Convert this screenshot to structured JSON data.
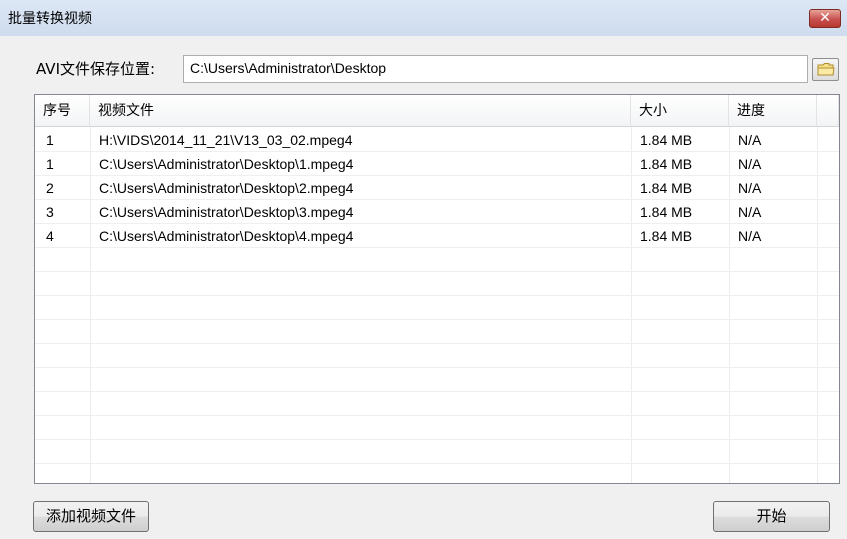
{
  "window": {
    "title": "批量转换视频",
    "close_label": "✕"
  },
  "save_location": {
    "label": "AVI文件保存位置:",
    "value": "C:\\Users\\Administrator\\Desktop"
  },
  "table": {
    "columns": [
      "序号",
      "视频文件",
      "大小",
      "进度"
    ],
    "rows": [
      [
        "1",
        "H:\\VIDS\\2014_11_21\\V13_03_02.mpeg4",
        "1.84 MB",
        "N/A"
      ],
      [
        "1",
        "C:\\Users\\Administrator\\Desktop\\1.mpeg4",
        "1.84 MB",
        "N/A"
      ],
      [
        "2",
        "C:\\Users\\Administrator\\Desktop\\2.mpeg4",
        "1.84 MB",
        "N/A"
      ],
      [
        "3",
        "C:\\Users\\Administrator\\Desktop\\3.mpeg4",
        "1.84 MB",
        "N/A"
      ],
      [
        "4",
        "C:\\Users\\Administrator\\Desktop\\4.mpeg4",
        "1.84 MB",
        "N/A"
      ]
    ]
  },
  "buttons": {
    "add_label": "添加视频文件",
    "start_label": "开始"
  },
  "icons": {
    "folder": "folder-icon",
    "close": "close-icon"
  },
  "colors": {
    "close_red": "#c75050",
    "titlebar": "#d6e2f2"
  }
}
